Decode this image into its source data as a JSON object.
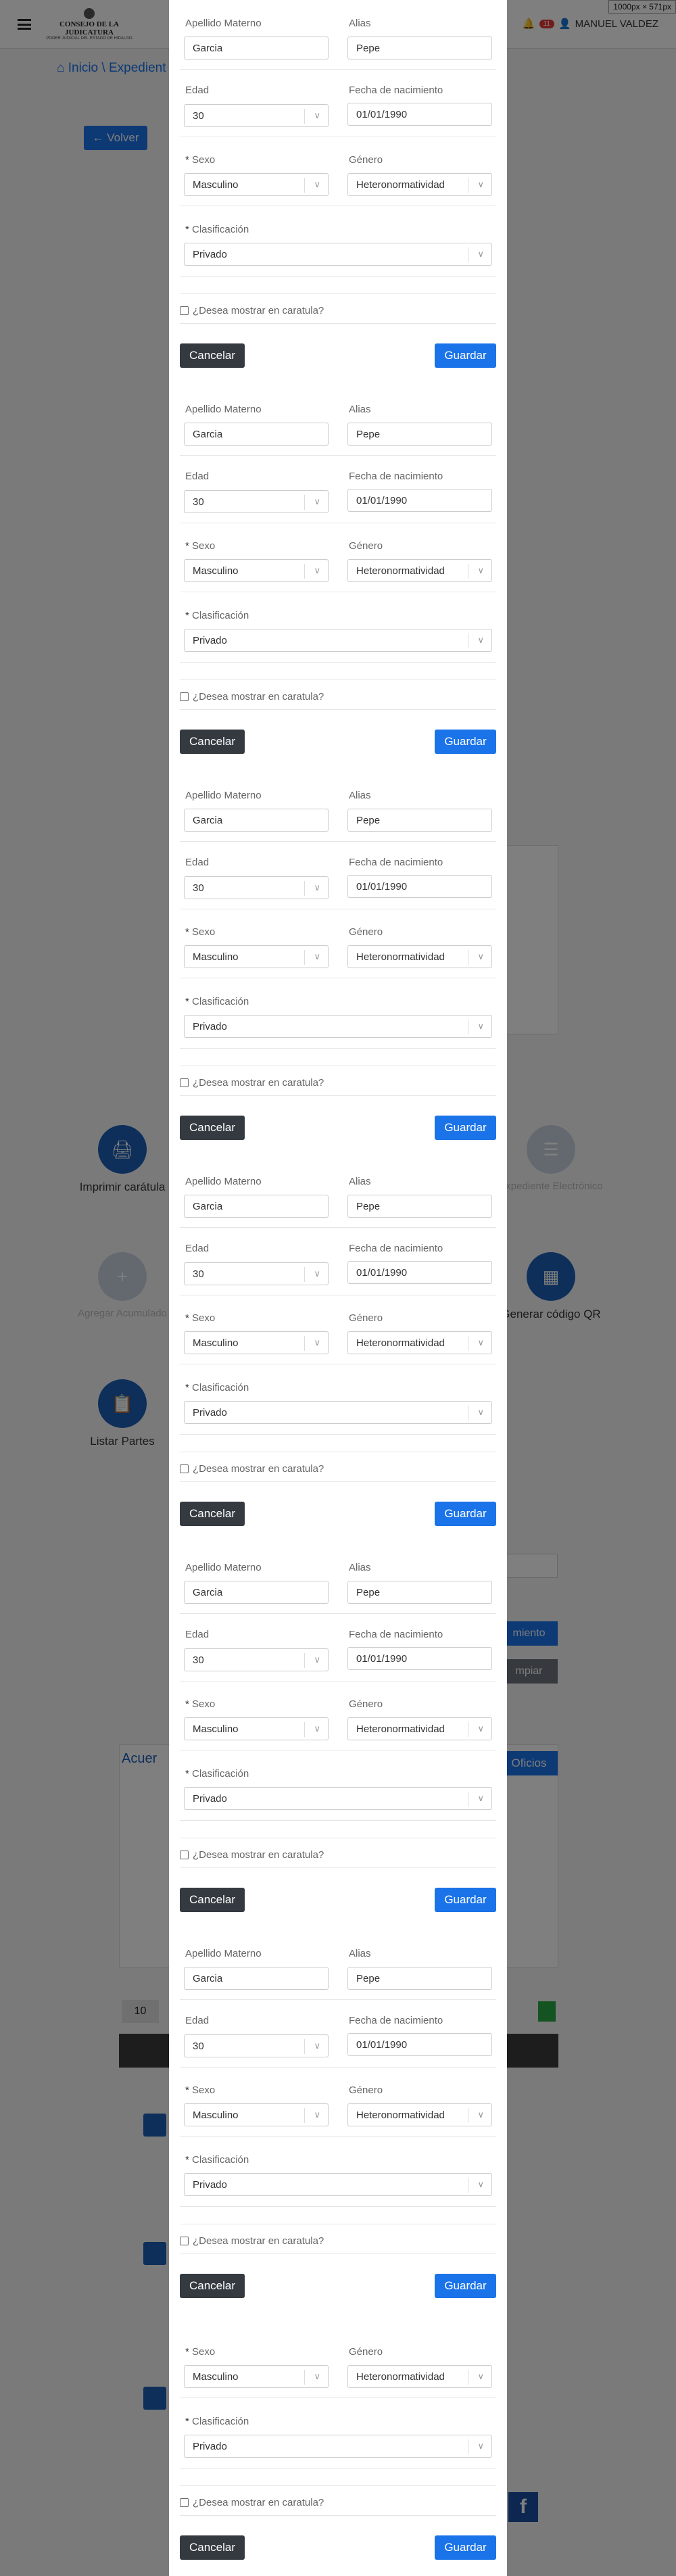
{
  "viewport_badge": "1000px × 571px",
  "navbar": {
    "logo_title": "CONSEJO DE LA JUDICATURA",
    "logo_sub": "PODER JUDICIAL DEL ESTADO DE HIDALGO",
    "notification_count": "11",
    "user_name": "MANUEL VALDEZ"
  },
  "breadcrumb": {
    "home": "Inicio",
    "separator": "\\",
    "current": "Expedient"
  },
  "back_button": "Volver",
  "background_actions": [
    {
      "label": "Imprimir carátula",
      "icon": "printer-icon",
      "disabled": false
    },
    {
      "label": "Expediente Electrónico",
      "icon": "list-icon",
      "disabled": true
    },
    {
      "label": "Agregar Acumulado",
      "icon": "plus-icon",
      "disabled": true
    },
    {
      "label": "Generar código QR",
      "icon": "qr-icon",
      "disabled": false
    },
    {
      "label": "Listar Partes",
      "icon": "clipboard-icon",
      "disabled": false
    }
  ],
  "background_buttons": {
    "search": "miento",
    "clear": "mpiar",
    "tab_left": "Acuer",
    "tab_right": "Oficios",
    "page_size": "10"
  },
  "form": {
    "labels": {
      "apellido_materno": "Apellido Materno",
      "alias": "Alias",
      "edad": "Edad",
      "fecha_nacimiento": "Fecha de nacimiento",
      "sexo": "Sexo",
      "genero": "Género",
      "clasificacion": "Clasificación",
      "required_mark": "*"
    },
    "values": {
      "apellido_materno": "Garcia",
      "alias": "Pepe",
      "edad": "30",
      "fecha_nacimiento": "01/01/1990",
      "sexo": "Masculino",
      "genero": "Heteronormatividad",
      "clasificacion": "Privado"
    },
    "checkbox_label": "¿Desea mostrar en caratula?",
    "cancel_label": "Cancelar",
    "save_label": "Guardar"
  },
  "colors": {
    "primary": "#1a73e8",
    "dark": "#343a40",
    "overlay": "rgba(0,0,0,0.5)"
  }
}
